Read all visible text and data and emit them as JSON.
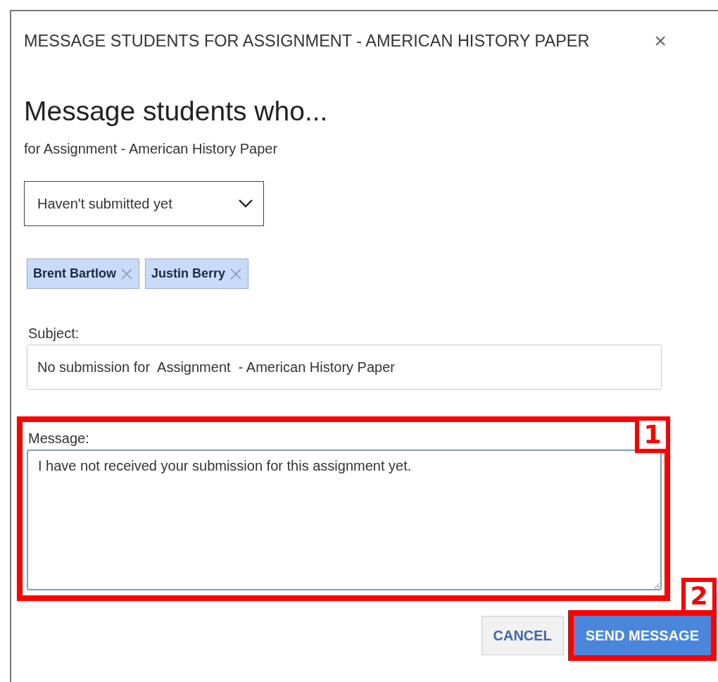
{
  "dialog": {
    "title": "MESSAGE STUDENTS FOR ASSIGNMENT - AMERICAN HISTORY PAPER",
    "close": "×"
  },
  "heading": "Message students who...",
  "subtitle": "for Assignment - American History Paper",
  "filter": {
    "value": "Haven't submitted yet"
  },
  "recipients": [
    {
      "name": "Brent Bartlow"
    },
    {
      "name": "Justin Berry"
    }
  ],
  "subject": {
    "label": "Subject:",
    "value": "No submission for  Assignment  - American History Paper"
  },
  "message": {
    "label": "Message:",
    "value": "I have not received your submission for this assignment yet.",
    "callout": "1"
  },
  "buttons": [
    {
      "label": "CANCEL",
      "kind": "secondary"
    },
    {
      "label": "SEND MESSAGE",
      "kind": "primary",
      "callout": "2"
    }
  ]
}
